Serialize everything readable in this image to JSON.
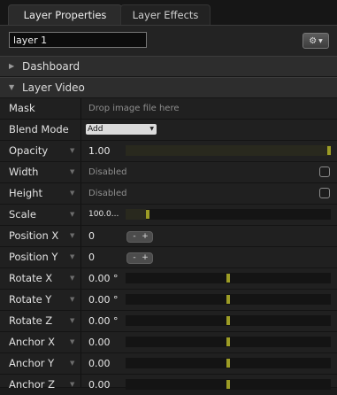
{
  "tabs": [
    {
      "label": "Layer Properties"
    },
    {
      "label": "Layer Effects"
    }
  ],
  "layer_name": "layer 1",
  "sections": {
    "dashboard": {
      "label": "Dashboard",
      "arrow": "▶"
    },
    "layer_video": {
      "label": "Layer Video",
      "arrow": "▼"
    }
  },
  "rows": {
    "mask": {
      "label": "Mask",
      "value": "Drop image file here"
    },
    "blend": {
      "label": "Blend Mode",
      "value": "Add"
    },
    "opacity": {
      "label": "Opacity",
      "value": "1.00",
      "level": 1.0
    },
    "width": {
      "label": "Width",
      "value": "Disabled"
    },
    "height": {
      "label": "Height",
      "value": "Disabled"
    },
    "scale": {
      "label": "Scale",
      "value": "100.0...",
      "level": 0.1
    },
    "position_x": {
      "label": "Position X",
      "value": "0"
    },
    "position_y": {
      "label": "Position Y",
      "value": "0"
    },
    "rotate_x": {
      "label": "Rotate X",
      "value": "0.00 °",
      "level": 0.5
    },
    "rotate_y": {
      "label": "Rotate Y",
      "value": "0.00 °",
      "level": 0.5
    },
    "rotate_z": {
      "label": "Rotate Z",
      "value": "0.00 °",
      "level": 0.5
    },
    "anchor_x": {
      "label": "Anchor X",
      "value": "0.00",
      "level": 0.5
    },
    "anchor_y": {
      "label": "Anchor Y",
      "value": "0.00",
      "level": 0.5
    },
    "anchor_z": {
      "label": "Anchor Z",
      "value": "0.00",
      "level": 0.5
    }
  },
  "stepper": {
    "minus": "-",
    "plus": "+"
  },
  "icons": {
    "gear": "gear-icon",
    "dropdown": "chevron-down-icon"
  },
  "colors": {
    "slider_thumb": "#9c9c25",
    "background": "#202020"
  }
}
